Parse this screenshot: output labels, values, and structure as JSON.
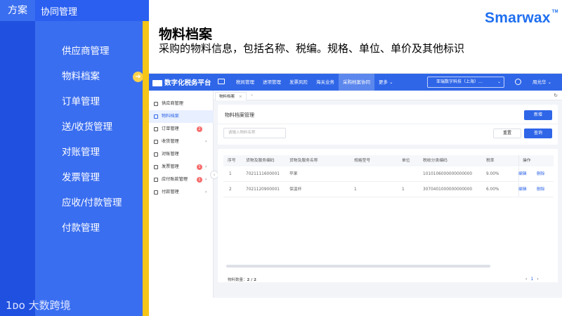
{
  "slide": {
    "scheme_tag": "方案",
    "section_tag": "协同管理",
    "title": "物料档案",
    "subtitle": "采购的物料信息，包括名称、税编。规格、单位、单价及其他标识",
    "brand": "Smarwax",
    "brand_mark": "TM",
    "bottom_logo": "1ᴅᴏ 大数跨境",
    "arrow_glyph": "➜",
    "accent_blue": "#1f50e0",
    "accent_yellow": "#f5c518"
  },
  "left_menu": [
    {
      "label": "供应商管理"
    },
    {
      "label": "物料档案",
      "active": true
    },
    {
      "label": "订单管理"
    },
    {
      "label": "送/收货管理"
    },
    {
      "label": "对账管理"
    },
    {
      "label": "发票管理"
    },
    {
      "label": "应收/付款管理"
    },
    {
      "label": "付款管理"
    }
  ],
  "app": {
    "platform_name": "数字化税务平台",
    "nav": [
      {
        "label": "税局管理"
      },
      {
        "label": "进项管理"
      },
      {
        "label": "发票风险"
      },
      {
        "label": "海关业务"
      },
      {
        "label": "采购档案协同",
        "active": true
      },
      {
        "label": "更多 ⌄"
      }
    ],
    "company": "亚瑞数字科技（上海）...",
    "user": "周光华 ⌄",
    "tab_label": "物料档案",
    "tab_close": "×",
    "tab_more": "⌄",
    "refresh": "↻",
    "collapse": "‹",
    "sidebar": [
      {
        "label": "供应商管理"
      },
      {
        "label": "物料档案",
        "active": true
      },
      {
        "label": "订单管理",
        "badge": "2"
      },
      {
        "label": "收货管理",
        "chevron": "›"
      },
      {
        "label": "对账管理"
      },
      {
        "label": "发票管理",
        "badge": "1",
        "chevron": "›"
      },
      {
        "label": "应付账款管理",
        "badge": "1",
        "chevron": "›"
      },
      {
        "label": "付款管理",
        "chevron": "›"
      }
    ],
    "card_title": "物料档案管理",
    "new_button": "新增",
    "search_placeholder": "请输入物料名称",
    "reset_button": "重置",
    "query_button": "查询",
    "table": {
      "columns": [
        "序号",
        "货物及服务编码",
        "货物及服务名称",
        "规格型号",
        "单位",
        "税收分类编码",
        "税率",
        "操作"
      ],
      "rows": [
        {
          "no": "1",
          "code": "7021111600001",
          "name": "苹果",
          "spec": "",
          "unit": "",
          "tax_code": "1010106000000000000",
          "rate": "9.00%",
          "edit": "编辑",
          "delete": "删除"
        },
        {
          "no": "2",
          "code": "7021120900001",
          "name": "保温杯",
          "spec": "1",
          "unit": "1",
          "tax_code": "3070401000000000000",
          "rate": "6.00%",
          "edit": "编辑",
          "delete": "删除"
        }
      ]
    },
    "total_label": "物料数量：",
    "total_value": "2 / 2",
    "pager_prev": "‹",
    "pager_page": "1",
    "pager_next": "›"
  }
}
